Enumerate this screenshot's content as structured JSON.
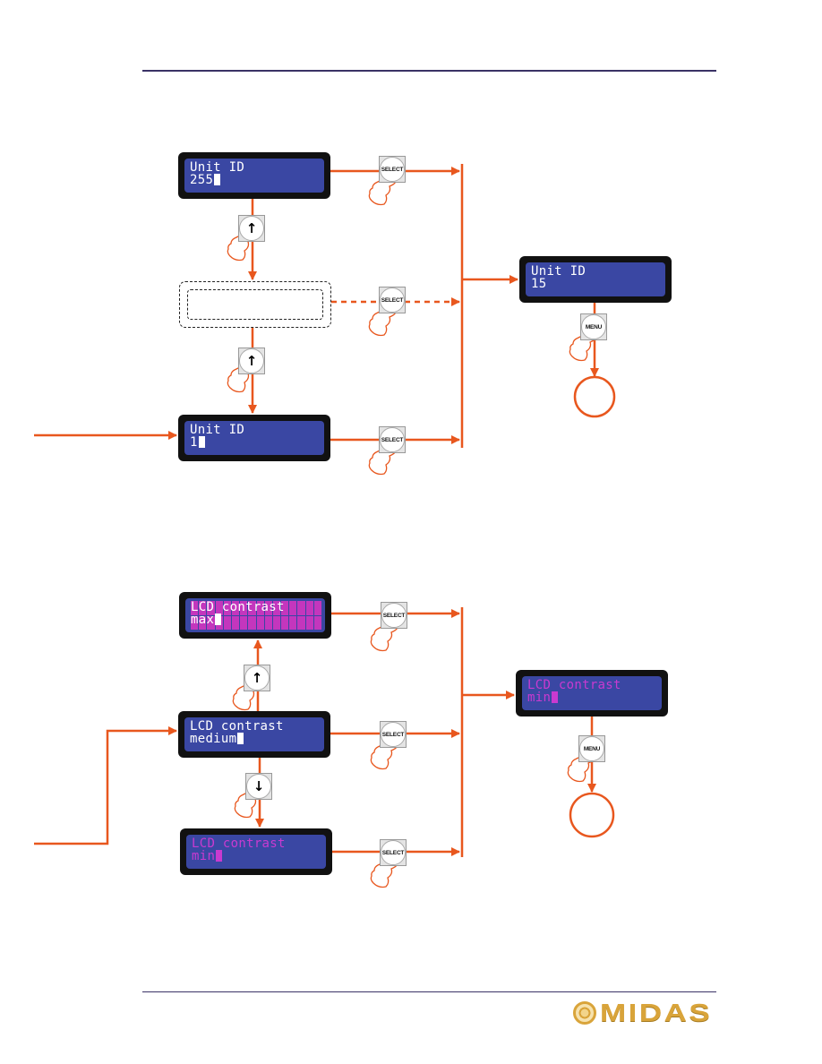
{
  "page": {
    "background": "#ffffff",
    "rule_color": "#3a3266",
    "flow_color": "#e8571e",
    "lcd_blue": "#3a47a3",
    "lcd_dim_text": "#c93ad0"
  },
  "flow1": {
    "start_display": {
      "line1": "Unit ID",
      "line2": "255"
    },
    "middle_display": {
      "line1": "",
      "line2": "",
      "placeholder": true
    },
    "entry_display": {
      "line1": "Unit ID",
      "line2": "1"
    },
    "result_display": {
      "line1": "Unit ID",
      "line2": "15"
    },
    "up_key_1": {
      "icon": "up-arrow-icon",
      "glyph": "↑"
    },
    "up_key_2": {
      "icon": "up-arrow-icon",
      "glyph": "↑"
    },
    "select_keys": [
      "SELECT",
      "SELECT",
      "SELECT"
    ],
    "menu_key": "MENU"
  },
  "flow2": {
    "max_display": {
      "line1": "LCD contrast",
      "line2": "max"
    },
    "entry_display": {
      "line1": "LCD contrast",
      "line2": "medium"
    },
    "min_display": {
      "line1": "LCD contrast",
      "line2": "min"
    },
    "result_display": {
      "line1": "LCD contrast",
      "line2": "min"
    },
    "up_key": {
      "icon": "up-arrow-icon",
      "glyph": "↑"
    },
    "down_key": {
      "icon": "down-arrow-icon",
      "glyph": "↓"
    },
    "select_keys": [
      "SELECT",
      "SELECT",
      "SELECT"
    ],
    "menu_key": "MENU"
  },
  "footer": {
    "logo_text": "MIDAS"
  }
}
